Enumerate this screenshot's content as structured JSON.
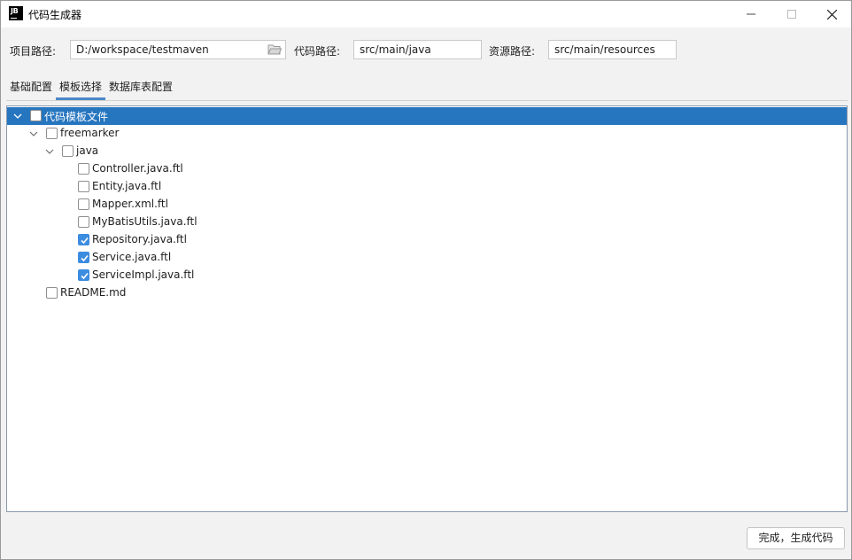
{
  "window": {
    "title": "代码生成器",
    "logo_text": "JB"
  },
  "paths": {
    "project_label": "项目路径:",
    "project_value": "D:/workspace/testmaven",
    "code_label": "代码路径:",
    "code_value": "src/main/java",
    "resource_label": "资源路径:",
    "resource_value": "src/main/resources"
  },
  "tabs": [
    {
      "label": "基础配置",
      "active": false
    },
    {
      "label": "模板选择",
      "active": true
    },
    {
      "label": "数据库表配置",
      "active": false
    }
  ],
  "tree": {
    "root": {
      "label": "代码模板文件",
      "checked": false,
      "expanded": true,
      "selected": true
    },
    "freemarker": {
      "label": "freemarker",
      "checked": false,
      "expanded": true
    },
    "java": {
      "label": "java",
      "checked": false,
      "expanded": true
    },
    "files": [
      {
        "label": "Controller.java.ftl",
        "checked": false
      },
      {
        "label": "Entity.java.ftl",
        "checked": false
      },
      {
        "label": "Mapper.xml.ftl",
        "checked": false
      },
      {
        "label": "MyBatisUtils.java.ftl",
        "checked": false
      },
      {
        "label": "Repository.java.ftl",
        "checked": true
      },
      {
        "label": "Service.java.ftl",
        "checked": true
      },
      {
        "label": "ServiceImpl.java.ftl",
        "checked": true
      }
    ],
    "readme": {
      "label": "README.md",
      "checked": false
    }
  },
  "footer": {
    "finish_label": "完成，生成代码"
  },
  "colors": {
    "selection": "#2675bf",
    "checkbox_checked": "#3c8ce0",
    "tab_underline": "#4a88c7"
  }
}
